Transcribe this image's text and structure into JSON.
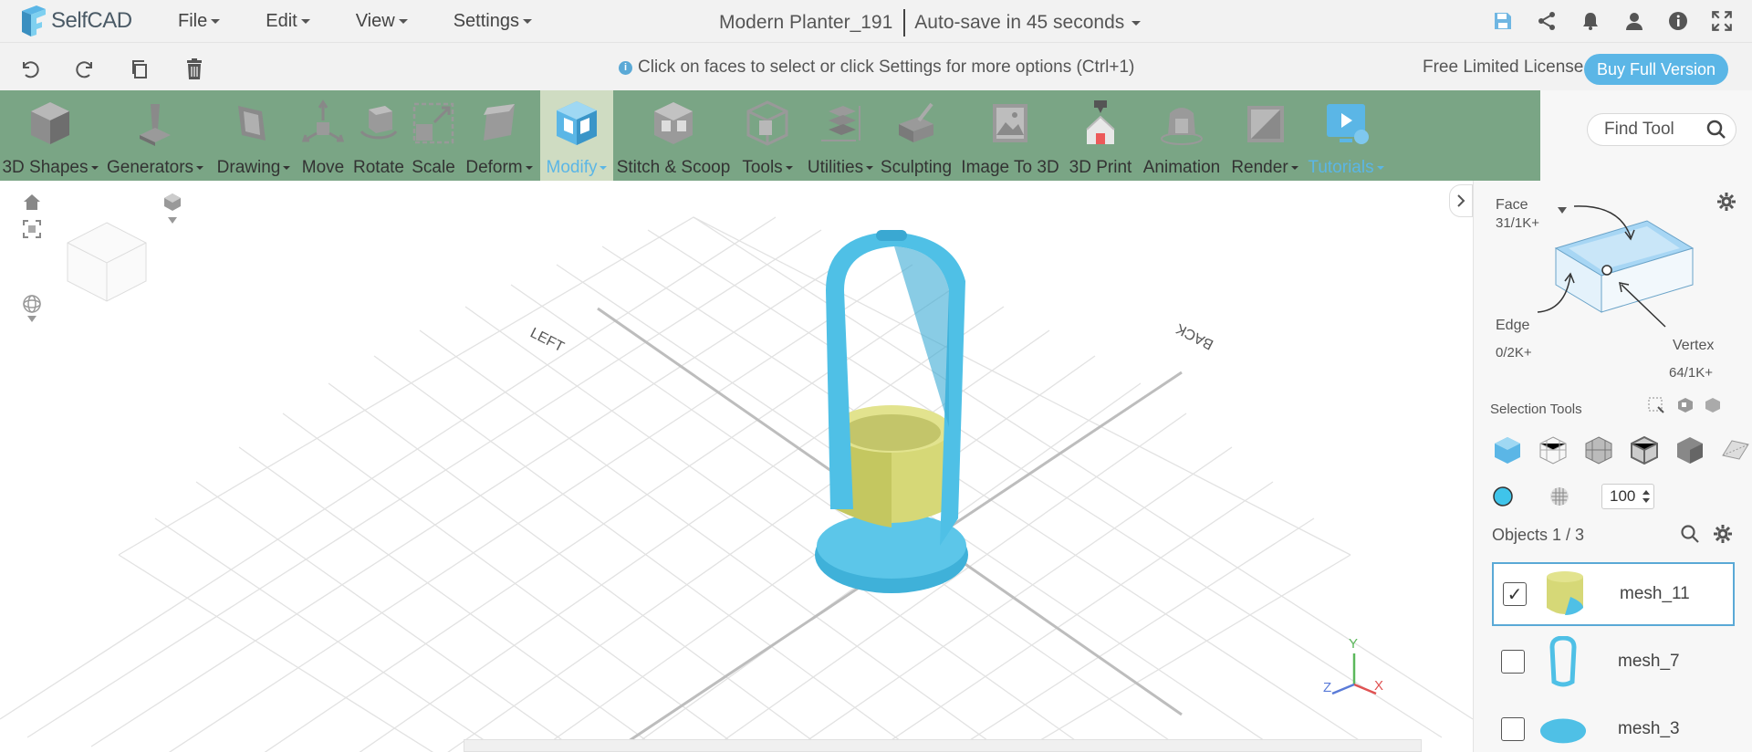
{
  "app": {
    "name": "SelfCAD"
  },
  "menus": [
    "File",
    "Edit",
    "View",
    "Settings"
  ],
  "document": {
    "title": "Modern Planter_191",
    "autosave": "Auto-save in 45 seconds"
  },
  "top_icons": [
    "save-icon",
    "share-icon",
    "bell-icon",
    "user-icon",
    "info-icon",
    "fullscreen-icon"
  ],
  "actions": [
    "undo-icon",
    "redo-icon",
    "copy-icon",
    "trash-icon"
  ],
  "hint": "Click on faces to select or click Settings for more options (Ctrl+1)",
  "license": {
    "text": "Free Limited License",
    "buy": "Buy Full Version"
  },
  "tools": [
    {
      "label": "3D Shapes",
      "dropdown": true
    },
    {
      "label": "Generators",
      "dropdown": true
    },
    {
      "label": "Drawing",
      "dropdown": true
    },
    {
      "label": "Move",
      "dropdown": false
    },
    {
      "label": "Rotate",
      "dropdown": false
    },
    {
      "label": "Scale",
      "dropdown": false
    },
    {
      "label": "Deform",
      "dropdown": true
    },
    {
      "label": "Modify",
      "dropdown": true,
      "active": true
    },
    {
      "label": "Stitch & Scoop",
      "dropdown": false
    },
    {
      "label": "Tools",
      "dropdown": true
    },
    {
      "label": "Utilities",
      "dropdown": true
    },
    {
      "label": "Sculpting",
      "dropdown": false
    },
    {
      "label": "Image To 3D",
      "dropdown": false
    },
    {
      "label": "3D Print",
      "dropdown": false
    },
    {
      "label": "Animation",
      "dropdown": false
    },
    {
      "label": "Render",
      "dropdown": true
    },
    {
      "label": "Tutorials",
      "dropdown": true
    }
  ],
  "find_tool": "Find Tool",
  "viewport": {
    "left_label": "LEFT",
    "back_label": "BACK",
    "axes": [
      "Y",
      "Z",
      "X"
    ]
  },
  "selection": {
    "face_label": "Face",
    "face_count": "31/1K+",
    "edge_label": "Edge",
    "edge_count": "0/2K+",
    "vertex_label": "Vertex",
    "vertex_count": "64/1K+",
    "tools_label": "Selection Tools",
    "brush_size": "100"
  },
  "objects": {
    "header": "Objects 1 / 3",
    "items": [
      {
        "name": "mesh_11",
        "checked": true
      },
      {
        "name": "mesh_7",
        "checked": false
      },
      {
        "name": "mesh_3",
        "checked": false
      }
    ]
  },
  "colors": {
    "toolbar": "#7aa585",
    "accent": "#5bb6e6",
    "model_blue": "#4fc0e6",
    "model_yellow": "#d6d877"
  }
}
